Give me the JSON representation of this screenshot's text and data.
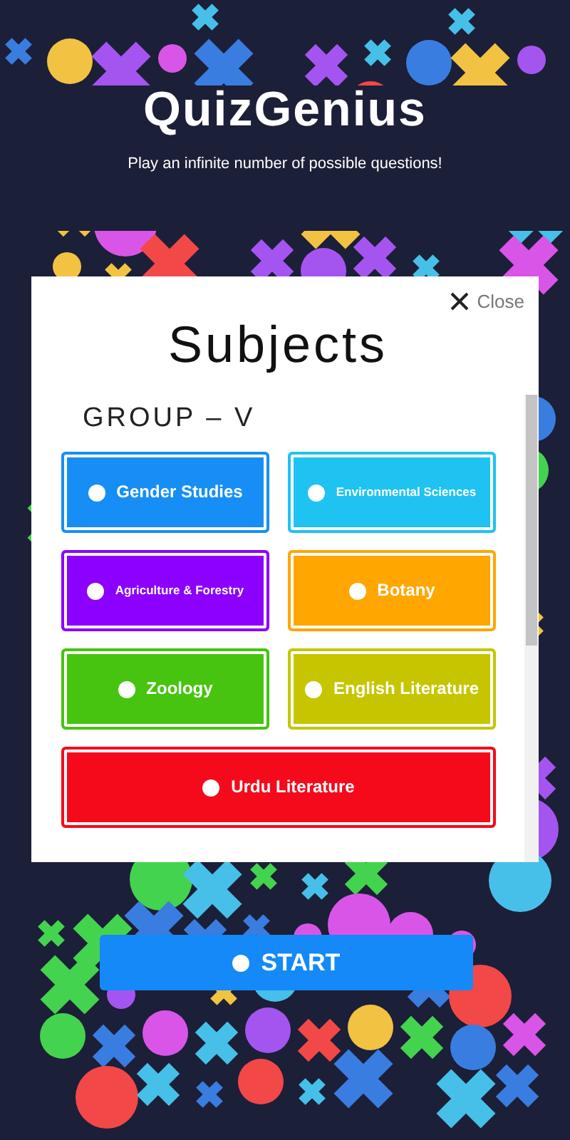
{
  "app": {
    "title": "QuizGenius",
    "subtitle": "Play an infinite number of possible questions!"
  },
  "dialog": {
    "close": "Close",
    "title": "Subjects",
    "group": "GROUP – V",
    "subjects": [
      {
        "label": "Gender Studies",
        "color": "#178ef5"
      },
      {
        "label": "Environmental Sciences",
        "color": "#1ec3f2"
      },
      {
        "label": "Agriculture & Forestry",
        "color": "#8c00ff"
      },
      {
        "label": "Botany",
        "color": "#ffa600"
      },
      {
        "label": "Zoology",
        "color": "#46c40f"
      },
      {
        "label": "English Literature",
        "color": "#c6c500"
      },
      {
        "label": "Urdu Literature",
        "color": "#f50a1c"
      }
    ]
  },
  "start_button": "START"
}
